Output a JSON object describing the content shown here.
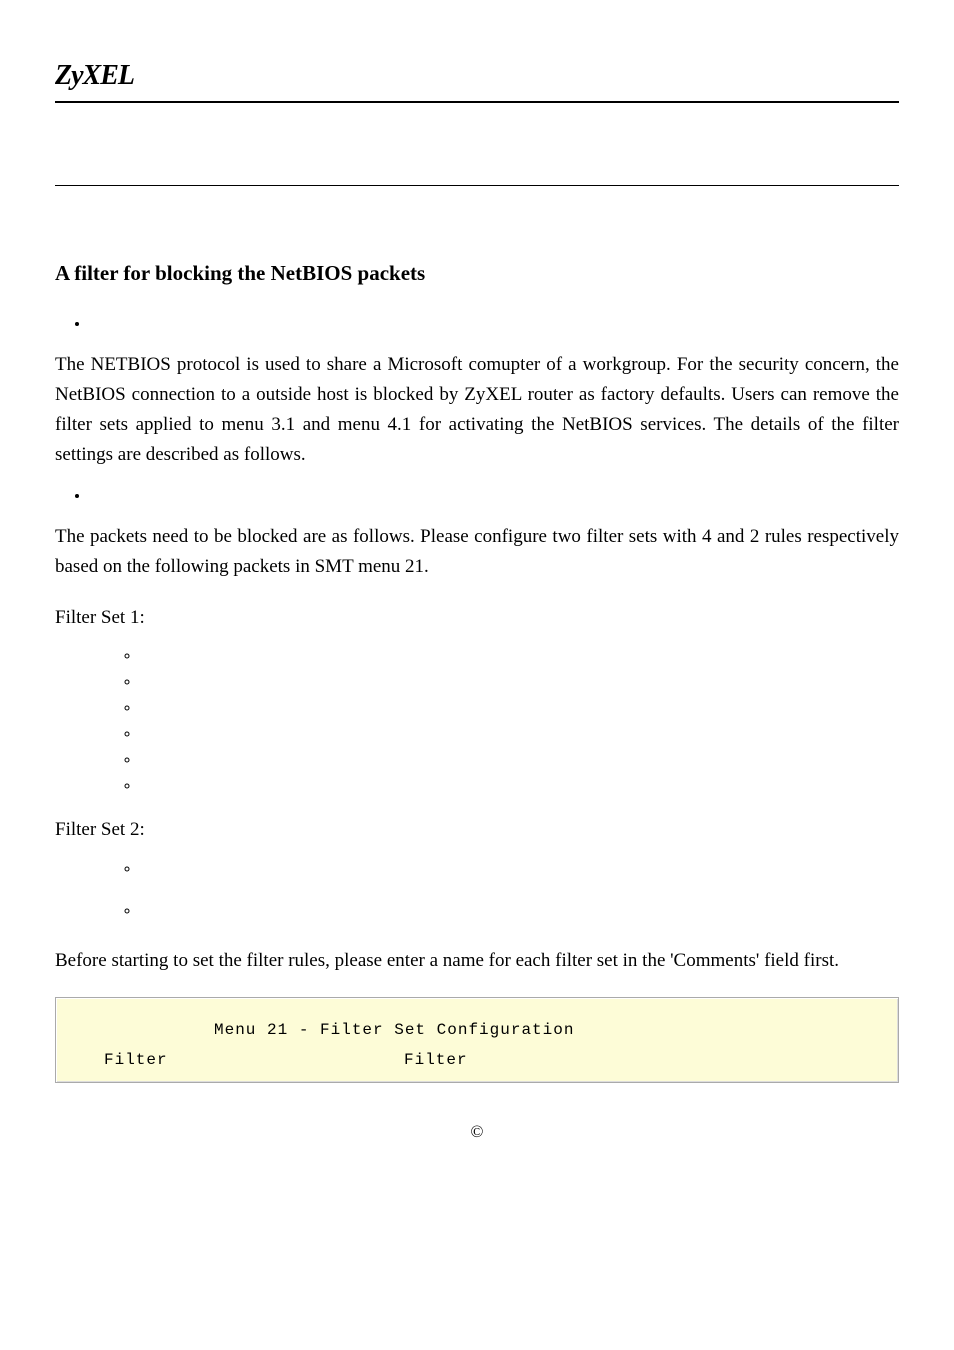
{
  "logo": "ZyXEL",
  "title": "A filter for blocking the NetBIOS packets",
  "para1": "The NETBIOS protocol is used to share a Microsoft comupter of a workgroup. For the security concern, the NetBIOS connection to a outside host is blocked by ZyXEL router as factory defaults. Users can remove the filter sets applied to menu 3.1 and menu 4.1 for activating the NetBIOS services. The details of the filter settings are described as follows.",
  "para2": "The packets need to be blocked are as follows. Please configure two filter sets with 4 and 2 rules respectively based on the following packets in SMT menu 21.",
  "filterset1_label": "Filter Set 1:",
  "filterset2_label": "Filter Set 2:",
  "filterset1_items": [
    "",
    "",
    "",
    "",
    "",
    ""
  ],
  "filterset2_items": [
    "",
    ""
  ],
  "before_text": "Before starting to set the filter rules, please enter a name for each filter set in the 'Comments' field first.",
  "terminal": {
    "line1": "Menu 21 - Filter Set Configuration",
    "line2_col1": "Filter",
    "line2_col2": "Filter"
  },
  "footer": "©"
}
